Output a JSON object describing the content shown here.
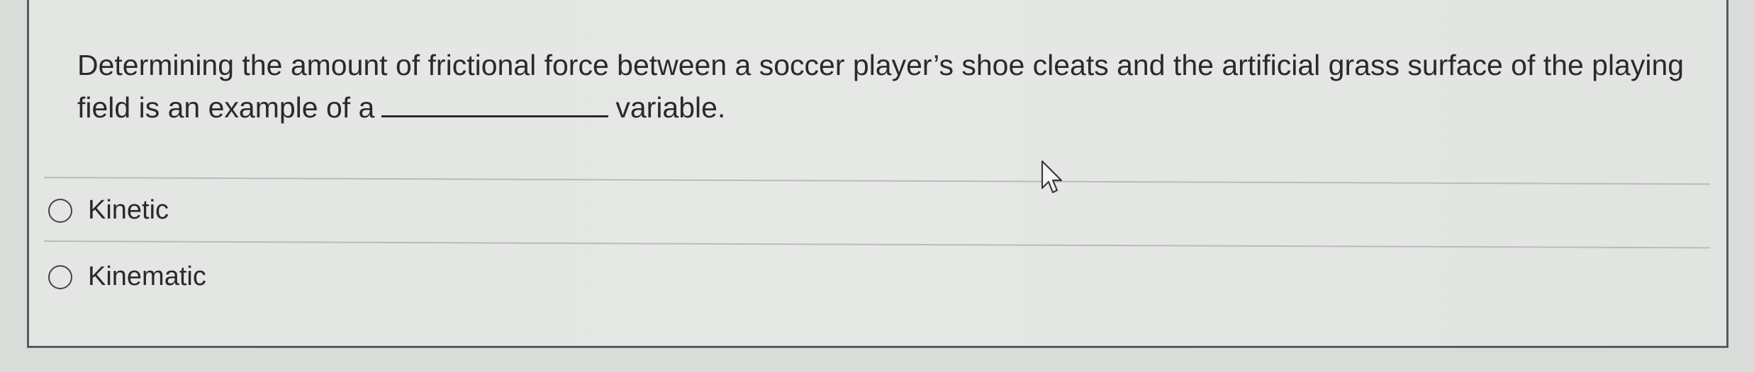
{
  "question": {
    "text_before": "Determining the amount of frictional force between a soccer player’s shoe cleats and the artificial grass surface of the playing field is an example of a",
    "text_after": "variable."
  },
  "options": [
    {
      "label": "Kinetic",
      "selected": false
    },
    {
      "label": "Kinematic",
      "selected": false
    }
  ],
  "colors": {
    "background": "#e4e6e4",
    "text": "#2a2a2a",
    "border": "#5a5c5b"
  },
  "icons": {
    "cursor": "mouse-pointer-icon",
    "radio": "radio-unchecked-icon"
  }
}
